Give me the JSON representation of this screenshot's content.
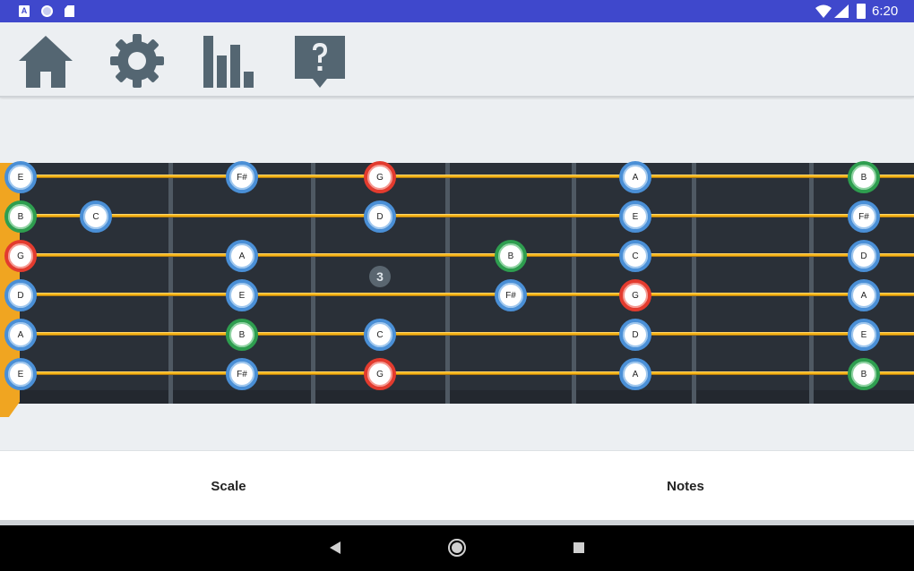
{
  "status_bar": {
    "time": "6:20",
    "notification_badge": "A",
    "icons": [
      "a-badge-icon",
      "circle-icon",
      "sd-card-icon",
      "wifi-icon",
      "signal-icon",
      "battery-charging-icon"
    ]
  },
  "toolbar": {
    "buttons": [
      "home-icon",
      "gear-icon",
      "bar-chart-icon",
      "help-icon"
    ],
    "icon_color": "#546672"
  },
  "fretboard": {
    "fret_number_marker": "3",
    "colors": {
      "blue": "#4a8fd6",
      "green": "#2e9e4f",
      "red": "#e33b2e",
      "string": "#f5b418",
      "neck": "#2a3038",
      "nut": "#f0a521"
    },
    "strings": [
      {
        "open": "E",
        "notes": [
          "E",
          "F#",
          "G",
          "A",
          "B"
        ]
      },
      {
        "open": "B",
        "notes": [
          "B",
          "C",
          "D",
          "E",
          "F#"
        ]
      },
      {
        "open": "G",
        "notes": [
          "G",
          "A",
          "B",
          "C",
          "D"
        ]
      },
      {
        "open": "D",
        "notes": [
          "D",
          "E",
          "F#",
          "G",
          "A"
        ]
      },
      {
        "open": "A",
        "notes": [
          "A",
          "B",
          "C",
          "D",
          "E"
        ]
      },
      {
        "open": "E",
        "notes": [
          "E",
          "F#",
          "G",
          "A",
          "B"
        ]
      }
    ]
  },
  "tabs": {
    "scale": "Scale",
    "notes": "Notes"
  },
  "nav": {
    "back": "back-icon",
    "home": "home-circle-icon",
    "recents": "recents-icon"
  }
}
